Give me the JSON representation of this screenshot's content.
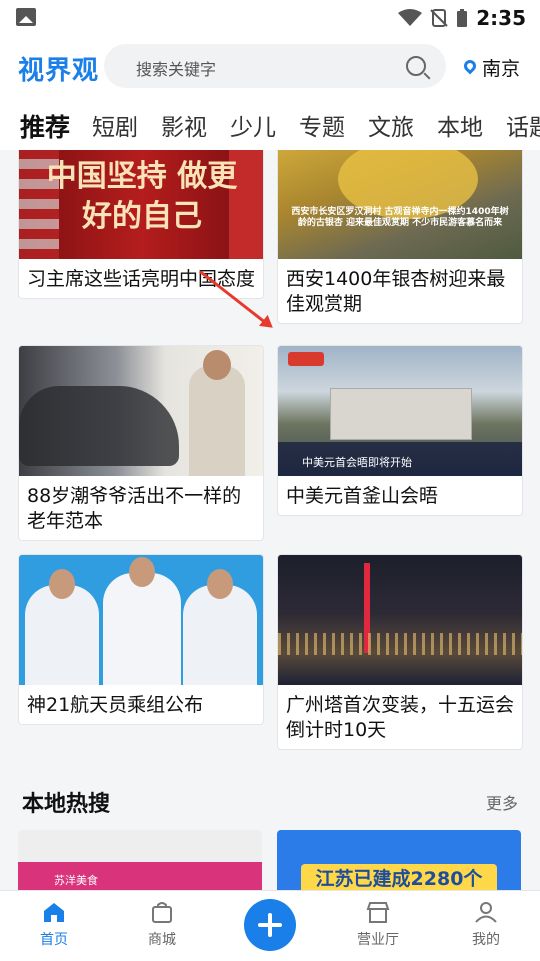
{
  "status": {
    "time": "2:35"
  },
  "header": {
    "logo": "视界观",
    "search_placeholder": "搜索关键字",
    "location": "南京"
  },
  "tabs": [
    "推荐",
    "短剧",
    "影视",
    "少儿",
    "专题",
    "文旅",
    "本地",
    "话题"
  ],
  "cards": [
    {
      "title": "习主席这些话亮明中国态度",
      "thumb_text": "中国坚持 做更好的自己"
    },
    {
      "title": "西安1400年银杏树迎来最佳观赏期",
      "thumb_text": "西安市长安区罗汉洞村 古观音禅寺内一棵约1400年树龄的古银杏 迎来最佳观赏期 不少市民游客慕名而来"
    },
    {
      "title": "88岁潮爷爷活出不一样的老年范本",
      "thumb_text": ""
    },
    {
      "title": "中美元首釜山会晤",
      "thumb_text": "中美元首会晤即将开始"
    },
    {
      "title": "神21航天员乘组公布",
      "thumb_text": ""
    },
    {
      "title": "广州塔首次变装，十五运会倒计时10天",
      "thumb_text": ""
    }
  ],
  "section": {
    "title": "本地热搜",
    "more": "更多"
  },
  "local_cards": [
    {
      "thumb_text": "苏洋美食"
    },
    {
      "thumb_text": "江苏已建成2280个"
    }
  ],
  "bottom_nav": [
    {
      "label": "首页",
      "icon": "home-icon"
    },
    {
      "label": "商城",
      "icon": "bag-icon"
    },
    {
      "label": "",
      "icon": "plus-icon"
    },
    {
      "label": "营业厅",
      "icon": "store-icon"
    },
    {
      "label": "我的",
      "icon": "user-icon"
    }
  ],
  "colors": {
    "accent": "#1a7fe8",
    "annotation_arrow": "#e8392d"
  }
}
